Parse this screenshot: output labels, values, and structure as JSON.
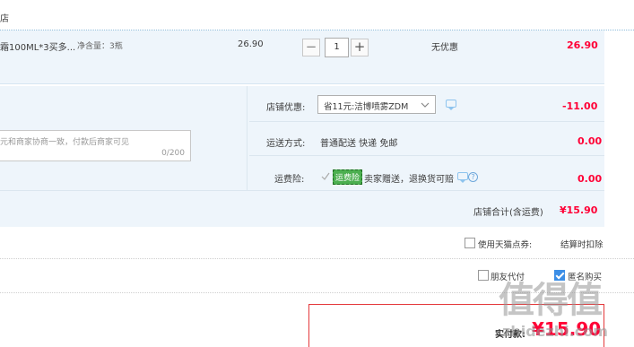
{
  "store": {
    "label": "店"
  },
  "item": {
    "title": "霜100ML*3买多...",
    "spec": "净含量：3瓶",
    "unit_price": "26.90",
    "quantity": "1",
    "minus": "−",
    "plus": "+",
    "discount": "无优惠",
    "subtotal": "26.90"
  },
  "summary": {
    "memo_text": "元和商家协商一致，付款后商家可见",
    "memo_count": "0/200",
    "store_discount_label": "店铺优惠:",
    "store_discount_option": "省11元:洁博喷雾ZDM",
    "store_discount_value": "-11.00",
    "shipping_label": "运送方式:",
    "shipping_value_text": "普通配送 快递 免邮",
    "shipping_value": "0.00",
    "insurance_label": "运费险:",
    "insurance_badge": "运费险",
    "insurance_text": "卖家赠送，退换货可赔",
    "insurance_value": "0.00",
    "total_label": "店铺合计(含运费)",
    "total_value": "¥15.90"
  },
  "options": {
    "tmall_points": "使用天猫点券:",
    "settle_label": "结算时扣除",
    "friend_pay": "朋友代付",
    "anonymous": "匿名购买"
  },
  "payment": {
    "label": "实付款:",
    "amount": "¥15.90"
  },
  "watermark": {
    "text": "值得值",
    "sub": "zhidezhi.com"
  },
  "colors": {
    "accent_red": "#ff0036",
    "row_bg": "#eef5fb",
    "checkbox_blue": "#3c8ee6",
    "badge_green": "#4caf50"
  }
}
